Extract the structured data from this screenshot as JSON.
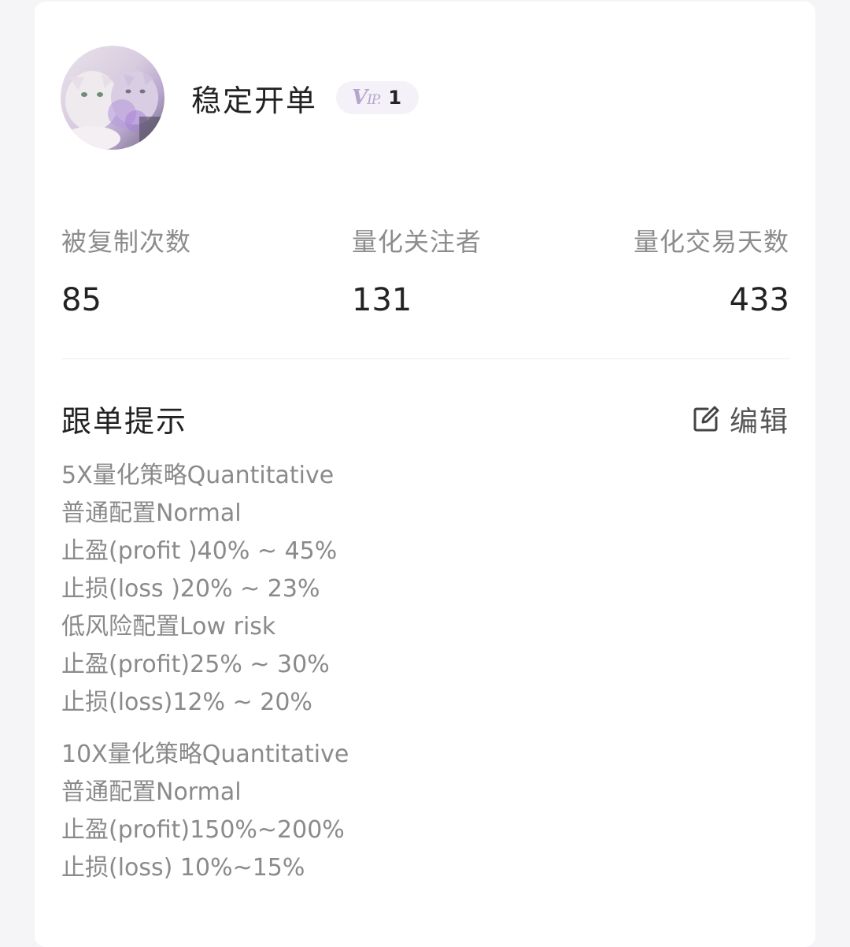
{
  "profile": {
    "username": "稳定开单",
    "vip_prefix": "V",
    "vip_suffix": "IP.",
    "vip_level": "1"
  },
  "stats": [
    {
      "label": "被复制次数",
      "value": "85"
    },
    {
      "label": "量化关注者",
      "value": "131"
    },
    {
      "label": "量化交易天数",
      "value": "433"
    }
  ],
  "follow_tips": {
    "title": "跟单提示",
    "edit_label": "编辑",
    "groups": [
      [
        "5X量化策略Quantitative",
        "普通配置Normal",
        "止盈(profit )40% ~ 45%",
        "止损(loss )20% ~ 23%",
        "低风险配置Low risk",
        "止盈(profit)25% ~ 30%",
        "止损(loss)12% ~ 20%"
      ],
      [
        "10X量化策略Quantitative",
        "普通配置Normal",
        "止盈(profit)150%~200%",
        "止损(loss) 10%~15%"
      ]
    ]
  },
  "colors": {
    "background": "#f5f5f7",
    "card": "#ffffff",
    "primary_text": "#222222",
    "secondary_text": "#8c8c8c",
    "vip_badge_bg": "#f4f1f8",
    "vip_icon": "#b4a6cc"
  },
  "icons": {
    "avatar": "cat-avatar-image",
    "vip": "vip-icon",
    "edit": "edit-icon"
  }
}
